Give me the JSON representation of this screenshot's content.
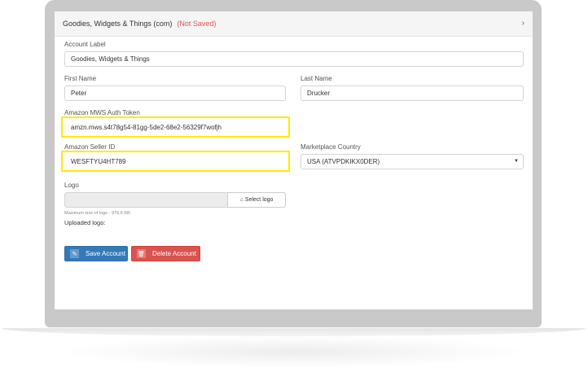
{
  "panel": {
    "title": "Goodies, Widgets & Things (com)",
    "status": "(Not Saved)",
    "chevron": "›"
  },
  "form": {
    "account_label": {
      "label": "Account Label",
      "value": "Goodies, Widgets & Things"
    },
    "first_name": {
      "label": "First Name",
      "value": "Peter"
    },
    "last_name": {
      "label": "Last Name",
      "value": "Drucker"
    },
    "auth_token": {
      "label": "Amazon MWS Auth Token",
      "value": "amzn.mws.s4t78g54-81gg-5de2-68e2-56329f7wofjh"
    },
    "seller_id": {
      "label": "Amazon Seller ID",
      "value": "WESFTYU4HT789"
    },
    "marketplace": {
      "label": "Marketplace Country",
      "value": "USA (ATVPDKIKX0DER)"
    },
    "logo": {
      "label": "Logo",
      "select_label": "Select logo",
      "hint": "Maximum size of logo - 976.6 KB.",
      "uploaded_label": "Uploaded logo:"
    }
  },
  "actions": {
    "save_label": "Save Account",
    "delete_label": "Delete Account"
  },
  "colors": {
    "highlight": "#ffeb00",
    "not_saved": "#e0524f",
    "save": "#337ab7",
    "delete": "#d9534f"
  }
}
